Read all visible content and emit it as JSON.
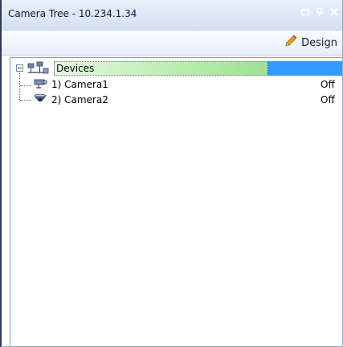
{
  "window": {
    "title": "Camera Tree - 10.234.1.34"
  },
  "title_controls": {
    "restore_icon": "window-restore-icon",
    "pin_icon": "pin-icon",
    "close_icon": "close-icon"
  },
  "toolbar": {
    "design_label": "Design",
    "design_icon": "pencil-icon"
  },
  "tree": {
    "root": {
      "label": "Devices",
      "icon": "devices-network-icon",
      "expanded": true
    },
    "items": [
      {
        "label": "1) Camera1",
        "status": "Off",
        "icon": "box-camera-icon"
      },
      {
        "label": "2) Camera2",
        "status": "Off",
        "icon": "dome-camera-icon"
      }
    ]
  },
  "colors": {
    "selection_green": "#9fe294",
    "selection_blue": "#3399ff",
    "titlebar": "#d4dff0"
  }
}
